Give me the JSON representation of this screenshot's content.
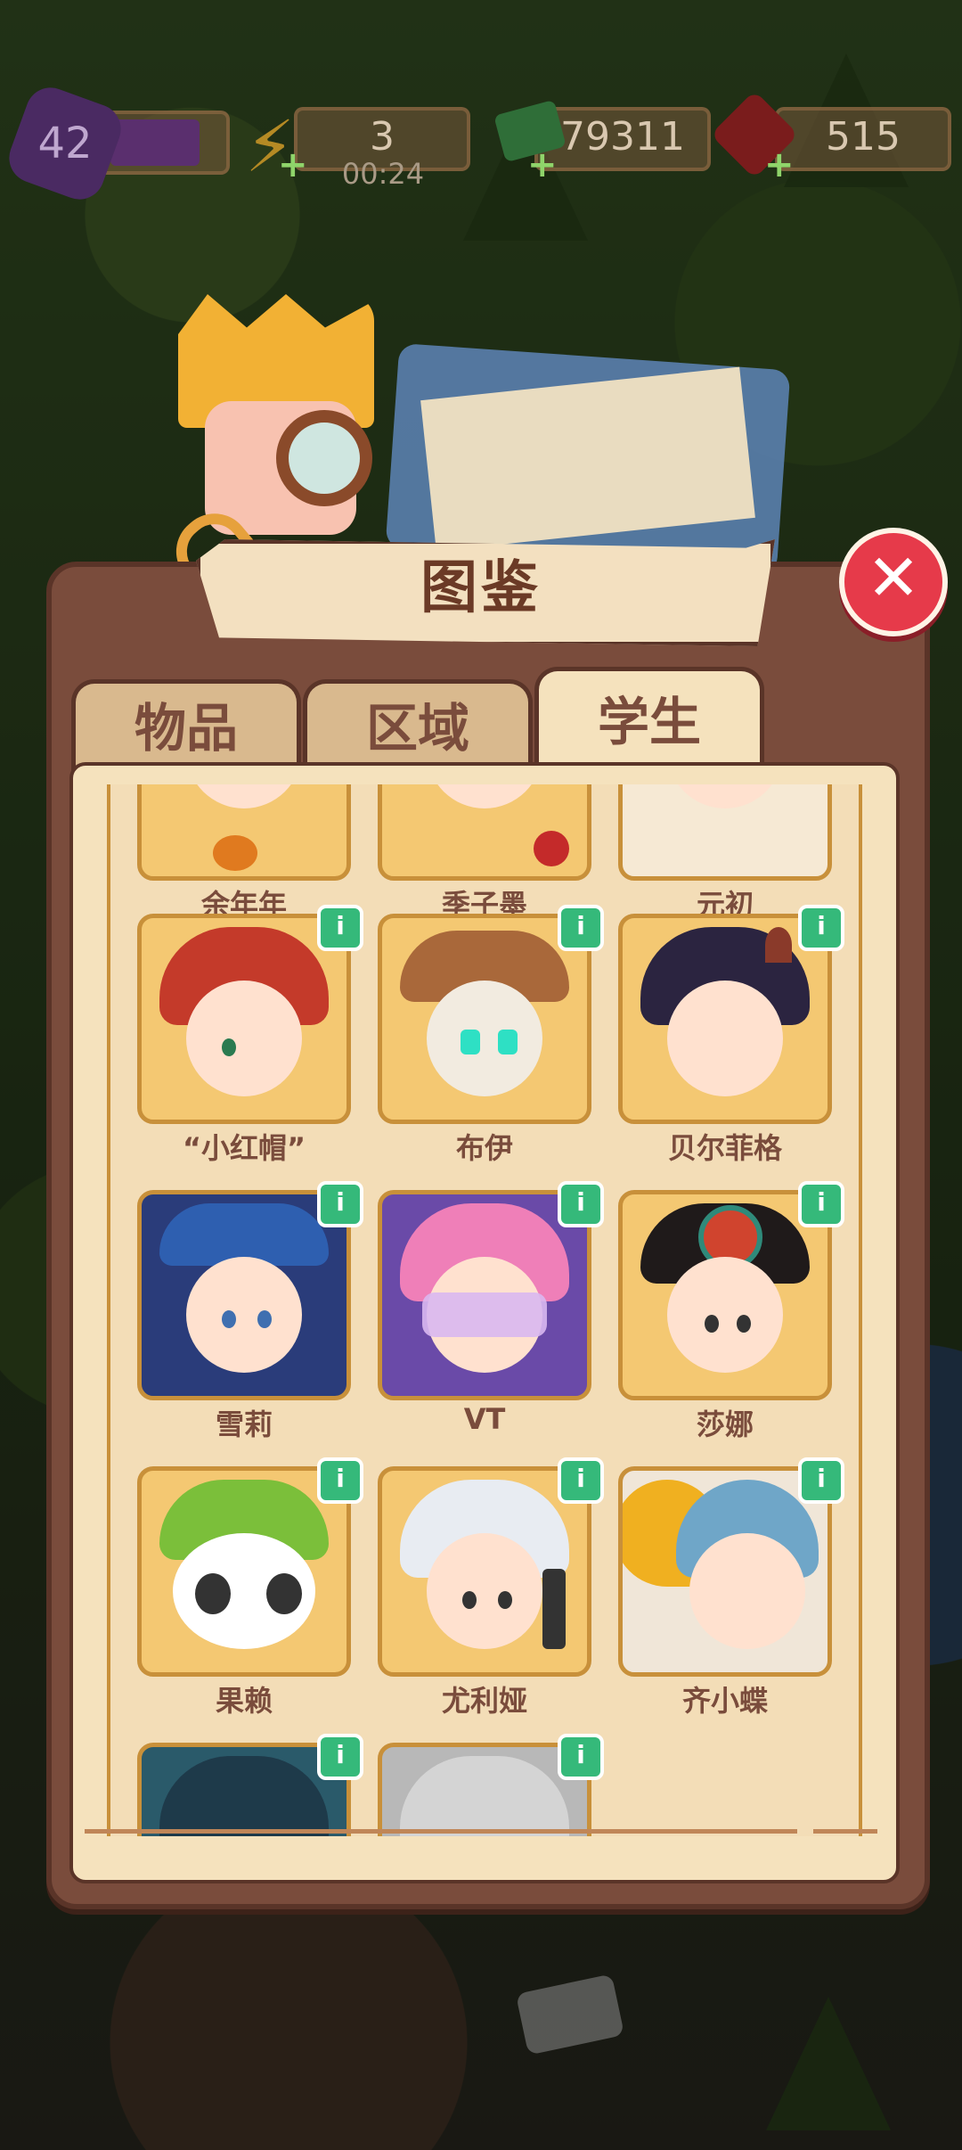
{
  "hud": {
    "level": "42",
    "energy": "3",
    "energy_timer": "00:24",
    "cash": "79311",
    "gems": "515"
  },
  "dialog": {
    "title": "图鉴",
    "close_label": "✕"
  },
  "tabs": [
    {
      "label": "物品",
      "active": false
    },
    {
      "label": "区域",
      "active": false
    },
    {
      "label": "学生",
      "active": true
    }
  ],
  "students": [
    {
      "name": "余年年",
      "info": false
    },
    {
      "name": "季子墨",
      "info": false
    },
    {
      "name": "元初",
      "info": false
    },
    {
      "name": "“小红帽”",
      "info": true
    },
    {
      "name": "布伊",
      "info": true
    },
    {
      "name": "贝尔菲格",
      "info": true
    },
    {
      "name": "雪莉",
      "info": true
    },
    {
      "name": "VT",
      "info": true
    },
    {
      "name": "莎娜",
      "info": true
    },
    {
      "name": "果赖",
      "info": true
    },
    {
      "name": "尤利娅",
      "info": true
    },
    {
      "name": "齐小蝶",
      "info": true
    },
    {
      "name": "",
      "info": true
    },
    {
      "name": "",
      "info": true
    }
  ],
  "info_glyph": "i",
  "colors": {
    "panel": "#7a4c3c",
    "content_bg": "#f5e2bd",
    "card_border": "#c8903a",
    "info_badge": "#35b97a",
    "close_button": "#e63a4a"
  }
}
